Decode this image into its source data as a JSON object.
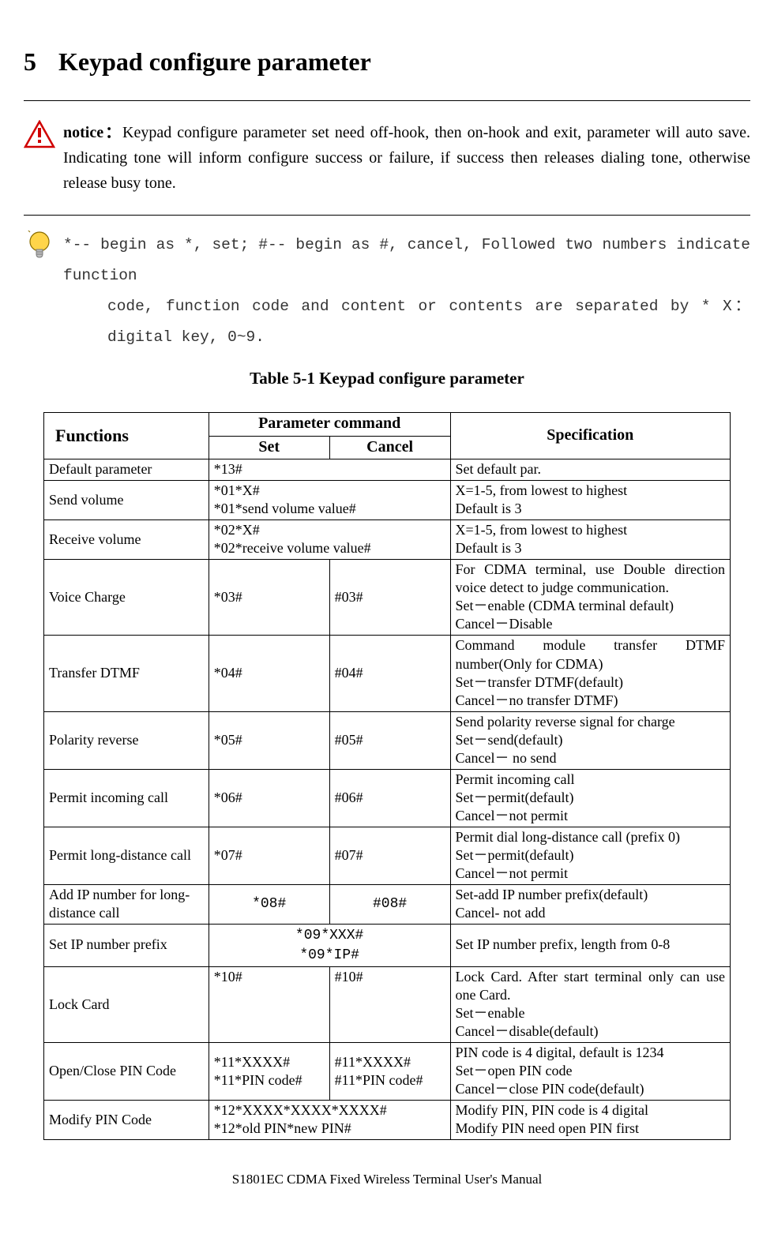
{
  "chapter_num": "5",
  "chapter_title": "Keypad configure parameter",
  "notice_label": "notice：",
  "notice_text": "Keypad configure parameter set need off-hook, then on-hook and exit, parameter will auto save. Indicating tone will inform configure success or failure, if success then releases dialing tone, otherwise release busy tone.",
  "bulb_line1": "*-- begin as *, set; #-- begin as #, cancel, Followed two numbers indicate function",
  "bulb_line2": "code, function code and content or contents are separated by * X：digital key, 0~9.",
  "table_caption": "Table 5-1 Keypad configure parameter",
  "thead": {
    "functions": "Functions",
    "param_cmd": "Parameter command",
    "set": "Set",
    "cancel": "Cancel",
    "spec": "Specification"
  },
  "rows": [
    {
      "fn": "Default parameter",
      "set": "*13#",
      "cancel_merge": true,
      "spec": "Set default par."
    },
    {
      "fn": "Send volume",
      "set": "*01*X#\n*01*send volume value#",
      "cancel_merge": true,
      "spec": "X=1-5, from lowest to highest\nDefault is 3"
    },
    {
      "fn": "Receive volume",
      "set": "*02*X#\n*02*receive volume value#",
      "cancel_merge": true,
      "spec": "X=1-5, from lowest to highest\nDefault is 3"
    },
    {
      "fn": "Voice Charge",
      "set": "*03#",
      "cancel": "#03#",
      "spec": "For CDMA terminal, use Double direction voice detect to judge communication.\nSet－enable (CDMA terminal default)\nCancel－Disable"
    },
    {
      "fn": "Transfer DTMF",
      "set": "*04#",
      "cancel": "#04#",
      "spec": "Command module transfer DTMF number(Only for CDMA)\nSet－transfer DTMF(default)\nCancel－no transfer DTMF)"
    },
    {
      "fn": "Polarity reverse",
      "set": "*05#",
      "cancel": "#05#",
      "spec": "Send polarity reverse signal for charge\nSet－send(default)\nCancel－  no send"
    },
    {
      "fn": "Permit incoming call",
      "set": "*06#",
      "cancel": "#06#",
      "spec": "Permit incoming call\nSet－permit(default)\nCancel－not permit"
    },
    {
      "fn": "Permit long-distance call",
      "set": "*07#",
      "cancel": "#07#",
      "spec": "Permit dial long-distance call (prefix 0)\nSet－permit(default)\nCancel－not permit"
    },
    {
      "fn": "Add IP number for long-distance call",
      "set_courier": "*08#",
      "cancel_courier": "#08#",
      "center": true,
      "spec": "Set-add IP number prefix(default)\nCancel- not add"
    },
    {
      "fn": "Set IP number prefix",
      "set_courier_merge": "*09*XXX#\n*09*IP#",
      "spec": "Set IP number prefix, length from 0-8"
    },
    {
      "fn": "Lock Card",
      "set": "*10#",
      "cancel": "#10#",
      "valign_top": true,
      "spec": "Lock Card. After start terminal only can use one Card.\nSet－enable\nCancel－disable(default)"
    },
    {
      "fn": "Open/Close PIN Code",
      "set": "*11*XXXX#\n*11*PIN code#",
      "cancel": "#11*XXXX#\n#11*PIN code#",
      "spec": "PIN code is 4 digital, default is 1234\nSet－open PIN code\nCancel－close PIN code(default)"
    },
    {
      "fn": "Modify PIN Code",
      "set": "*12*XXXX*XXXX*XXXX#\n*12*old PIN*new PIN#",
      "cancel_merge": true,
      "spec": "Modify PIN, PIN code is 4 digital\nModify PIN need open PIN first"
    }
  ],
  "footer": "S1801EC CDMA Fixed Wireless Terminal User's Manual"
}
